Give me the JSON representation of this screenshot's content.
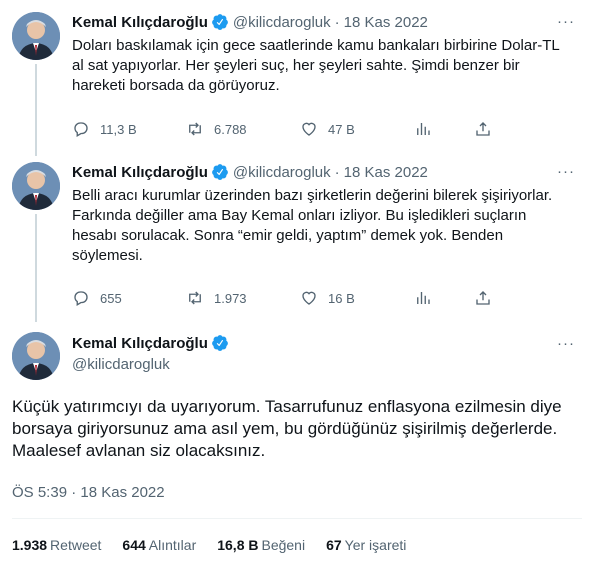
{
  "author": {
    "name": "Kemal Kılıçdaroğlu",
    "handle": "@kilicdarogluk"
  },
  "tweets": [
    {
      "date": "18 Kas 2022",
      "text": "Doları baskılamak için gece saatlerinde kamu bankaları birbirine Dolar-TL al sat yapıyorlar. Her şeyleri suç, her şeyleri sahte. Şimdi benzer bir hareketi borsada da görüyoruz.",
      "replies": "11,3 B",
      "retweets": "6.788",
      "likes": "47 B"
    },
    {
      "date": "18 Kas 2022",
      "text": "Belli aracı kurumlar üzerinden bazı şirketlerin değerini bilerek şişiriyorlar. Farkında değiller ama Bay Kemal onları izliyor. Bu işledikleri suçların hesabı sorulacak. Sonra “emir geldi, yaptım” demek yok. Benden söylemesi.",
      "replies": "655",
      "retweets": "1.973",
      "likes": "16 B"
    }
  ],
  "main_tweet": {
    "text": "Küçük yatırımcıyı da uyarıyorum. Tasarrufunuz enflasyona ezilmesin diye borsaya giriyorsunuz ama asıl yem, bu gördüğünüz şişirilmiş değerlerde. Maalesef avlanan siz olacaksınız.",
    "timestamp": "ÖS 5:39 · 18 Kas 2022",
    "stats": {
      "retweets_count": "1.938",
      "retweets_label": "Retweet",
      "quotes_count": "644",
      "quotes_label": "Alıntılar",
      "likes_count": "16,8 B",
      "likes_label": "Beğeni",
      "bookmarks_count": "67",
      "bookmarks_label": "Yer işareti"
    }
  },
  "separator_dot": "·",
  "more_glyph": "···",
  "colors": {
    "text": "#0f1419",
    "secondary": "#536471",
    "verified": "#1d9bf0",
    "thread_line": "#cfd9de"
  },
  "icons": [
    "reply-icon",
    "retweet-icon",
    "like-icon",
    "analytics-icon",
    "share-icon",
    "verified-badge-icon",
    "more-icon"
  ]
}
